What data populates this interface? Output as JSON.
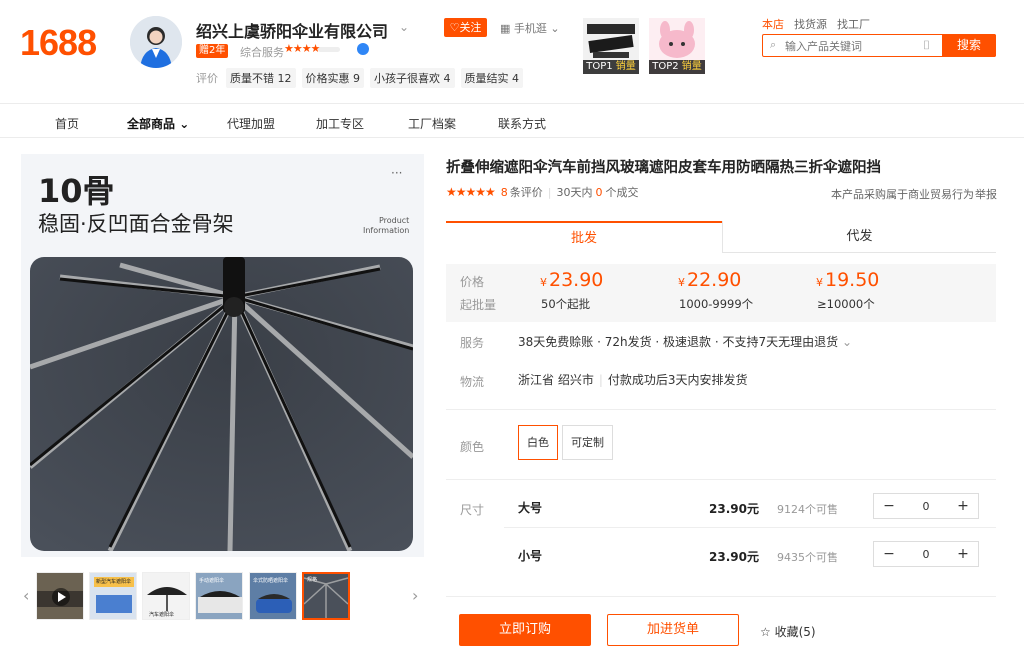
{
  "header": {
    "logo": "1688",
    "company_name": "绍兴上虞骄阳伞业有限公司",
    "year_badge": "赠2年",
    "service_label": "综合服务",
    "service_stars": "★★★★",
    "reviews_label": "评价",
    "review_tags": [
      "质量不错 12",
      "价格实惠 9",
      "小孩子很喜欢 4",
      "质量结实 4"
    ],
    "follow_label": "关注",
    "mobile_label": "手机逛",
    "top_products": [
      {
        "rank": "TOP1",
        "label": "销量"
      },
      {
        "rank": "TOP2",
        "label": "销量"
      }
    ],
    "search_tabs": [
      "本店",
      "找货源",
      "找工厂"
    ],
    "search_placeholder": "输入产品关键词",
    "search_button": "搜索",
    "accent_color": "#ff5000"
  },
  "shop_nav": {
    "items": [
      "首页",
      "全部商品",
      "代理加盟",
      "加工专区",
      "工厂档案",
      "联系方式"
    ]
  },
  "main_image": {
    "headline": "10骨",
    "subline": "稳固·反凹面合金骨架",
    "product_info_1": "Product",
    "product_info_2": "Information",
    "more": "···"
  },
  "thumbnails": {
    "count": 6,
    "active_index": 5,
    "thumb_texts": [
      "新型汽车遮阳伞",
      "汽车遮阳伞",
      "手动遮阳伞",
      "伞式防晒遮阳伞",
      "",
      "规格"
    ]
  },
  "product": {
    "title": "折叠伸缩遮阳伞汽车前挡风玻璃遮阳皮套车用防晒隔热三折伞遮阳挡",
    "stars": "★★★★★",
    "review_count": "8",
    "review_unit": "条评价",
    "sales_prefix": "30天内",
    "sales_count": "0",
    "sales_unit": "个成交",
    "trade_note": "本产品采购属于商业贸易行为",
    "report_label": "举报",
    "tabs": [
      "批发",
      "代发"
    ],
    "price_label": "价格",
    "moq_label": "起批量",
    "currency": "¥",
    "tiers": [
      {
        "price": "23.90",
        "qty": "50个起批"
      },
      {
        "price": "22.90",
        "qty": "1000-9999个"
      },
      {
        "price": "19.50",
        "qty": "≥10000个"
      }
    ],
    "service_label": "服务",
    "service_text": "38天免费赊账 · 72h发货 · 极速退款 · 不支持7天无理由退货",
    "logistics_label": "物流",
    "logistics_origin": "浙江省 绍兴市",
    "logistics_note": "付款成功后3天内安排发货",
    "color_label": "颜色",
    "colors": [
      "白色",
      "可定制"
    ],
    "selected_color": "白色",
    "size_label": "尺寸",
    "sizes": [
      {
        "name": "大号",
        "price": "23.90元",
        "stock": "9124个可售",
        "qty": "0"
      },
      {
        "name": "小号",
        "price": "23.90元",
        "stock": "9435个可售",
        "qty": "0"
      }
    ],
    "order_button": "立即订购",
    "cart_button": "加进货单",
    "favorite_label": "收藏(5)"
  }
}
